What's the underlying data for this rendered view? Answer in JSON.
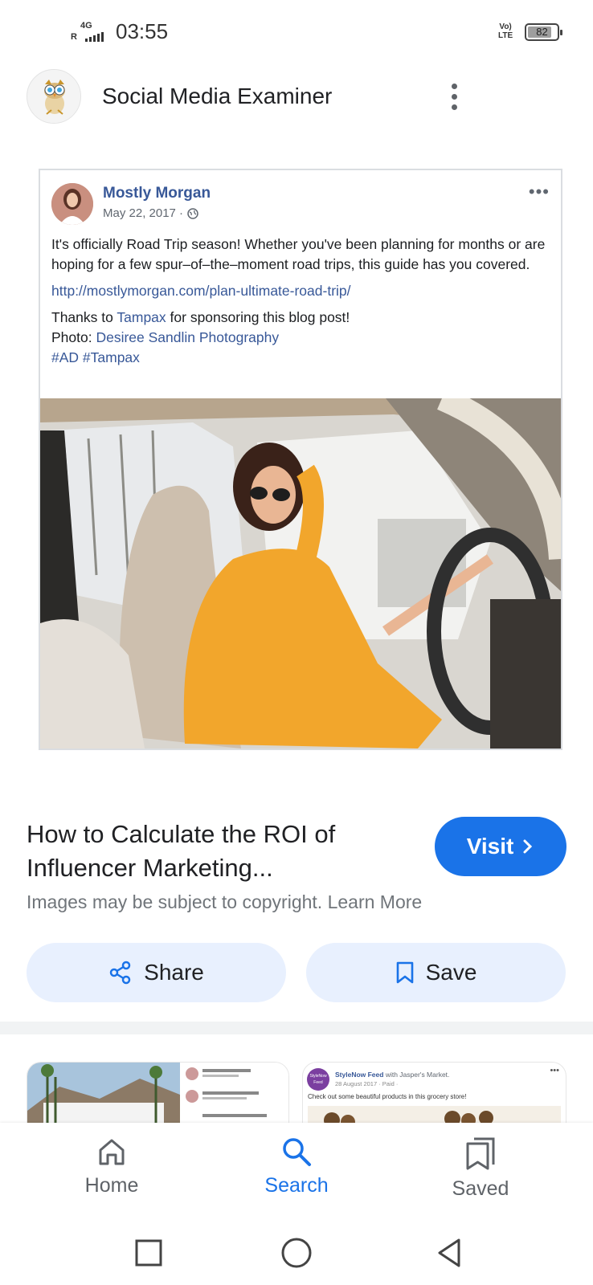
{
  "status_bar": {
    "network": "4G",
    "roaming": "R",
    "time": "03:55",
    "volte": "Vo) LTE",
    "battery_level": "82",
    "battery_fraction": 0.82
  },
  "header": {
    "site_name": "Social Media Examiner",
    "avatar_icon": "owl-mascot-icon",
    "more_icon": "more-vert-icon"
  },
  "post": {
    "author": "Mostly Morgan",
    "date": "May 22, 2017 ·",
    "more": "•••",
    "body": "It's officially Road Trip season! Whether you've been planning for months or are hoping for a few spur–of–the–moment road trips, this guide has you covered.",
    "link": "http://mostlymorgan.com/plan-ultimate-road-trip/",
    "thanks_prefix": "Thanks to ",
    "thanks_link": "Tampax",
    "thanks_suffix": " for sponsoring this blog post!",
    "photo_prefix": "Photo: ",
    "photo_credit": "Desiree Sandlin Photography",
    "hashtags": "#AD #Tampax"
  },
  "result": {
    "title": "How to Calculate the ROI of Influencer Marketing...",
    "visit_label": "Visit",
    "copyright": "Images may be subject to copyright. Learn More"
  },
  "actions": {
    "share_label": "Share",
    "save_label": "Save"
  },
  "related": {
    "second": {
      "author": "StyleNow Feed",
      "with": " with Jasper's Market.",
      "date": "28 August 2017 · Paid · ",
      "text": "Check out some beautiful products in this grocery store!",
      "logo": "StyleNow Feed"
    }
  },
  "bottom_nav": {
    "home": "Home",
    "search": "Search",
    "saved": "Saved"
  },
  "colors": {
    "accent": "#1a73e8",
    "pill_bg": "#e8f0fe",
    "fb_link": "#385898"
  }
}
